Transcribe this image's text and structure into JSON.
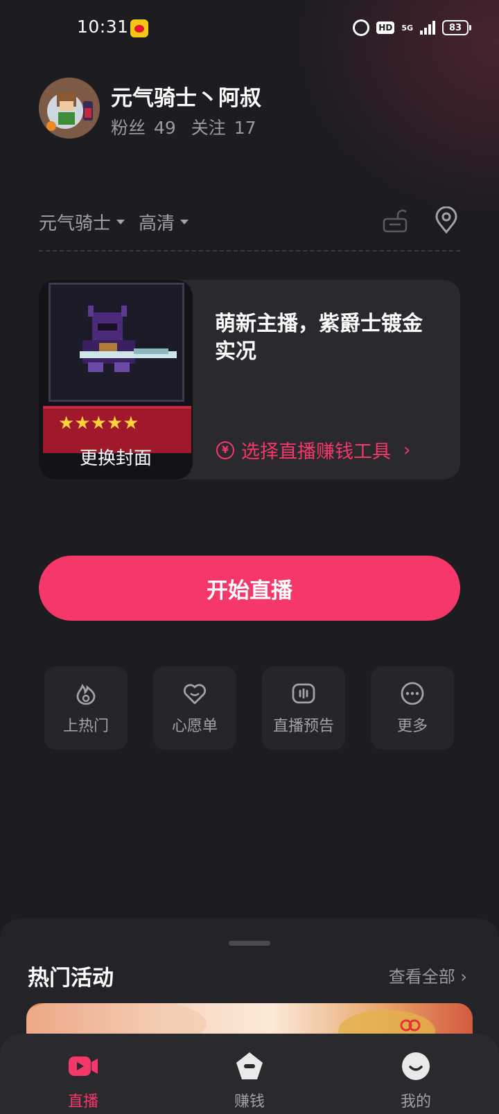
{
  "status_bar": {
    "time": "10:31",
    "hd": "HD",
    "network": "5G",
    "battery": "83",
    "icons": [
      "weibo-icon",
      "alarm-icon",
      "signal-icon",
      "battery-icon"
    ]
  },
  "profile": {
    "name": "元气骑士丶阿叔",
    "fans_label": "粉丝",
    "fans_count": "49",
    "follow_label": "关注",
    "follow_count": "17"
  },
  "selectors": {
    "category": "元气骑士",
    "quality": "高清"
  },
  "cover": {
    "change_label": "更换封面",
    "title": "萌新主播，紫爵士镀金实况",
    "earn_tools_label": "选择直播赚钱工具",
    "stars": "★★★★★"
  },
  "start_button": "开始直播",
  "tiles": [
    {
      "label": "上热门",
      "icon": "flame-icon"
    },
    {
      "label": "心愿单",
      "icon": "heart-smile-icon"
    },
    {
      "label": "直播预告",
      "icon": "broadcast-preview-icon"
    },
    {
      "label": "更多",
      "icon": "more-dots-icon"
    }
  ],
  "activities": {
    "title": "热门活动",
    "see_all": "查看全部",
    "chevron": "›"
  },
  "bottom_nav": [
    {
      "label": "直播",
      "icon": "live-camera-icon",
      "active": true
    },
    {
      "label": "赚钱",
      "icon": "earn-icon",
      "active": false
    },
    {
      "label": "我的",
      "icon": "profile-smile-icon",
      "active": false
    }
  ],
  "colors": {
    "accent": "#f5376a",
    "background": "#1d1c21",
    "card": "#2a292e",
    "muted_text": "#a3a2a9"
  }
}
